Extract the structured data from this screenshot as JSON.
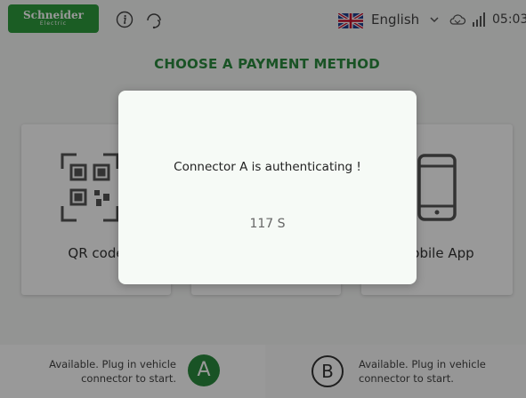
{
  "header": {
    "logo": {
      "line1": "Schneider",
      "line2": "Electric"
    },
    "language": "English",
    "time": "05:03"
  },
  "main": {
    "title": "CHOOSE A PAYMENT METHOD",
    "payment_methods": [
      {
        "label": "QR code",
        "icon": "qr-code-icon"
      },
      {
        "label": "",
        "icon": ""
      },
      {
        "label": "Mobile App",
        "icon": "mobile-phone-icon"
      }
    ]
  },
  "connectors": [
    {
      "letter": "A",
      "status": "Available. Plug in vehicle connector to start.",
      "color": "#2b8a3e"
    },
    {
      "letter": "B",
      "status": "Available. Plug in vehicle connector to start.",
      "color": "#333333"
    }
  ],
  "dialog": {
    "message": "Connector A is authenticating !",
    "countdown": "117 S"
  },
  "colors": {
    "brand": "#2e9b3d",
    "accent": "#2b8a3e"
  },
  "icons": [
    "info-icon",
    "headset-help-icon",
    "uk-flag-icon",
    "chevron-down-icon",
    "cloud-icon",
    "signal-icon"
  ]
}
